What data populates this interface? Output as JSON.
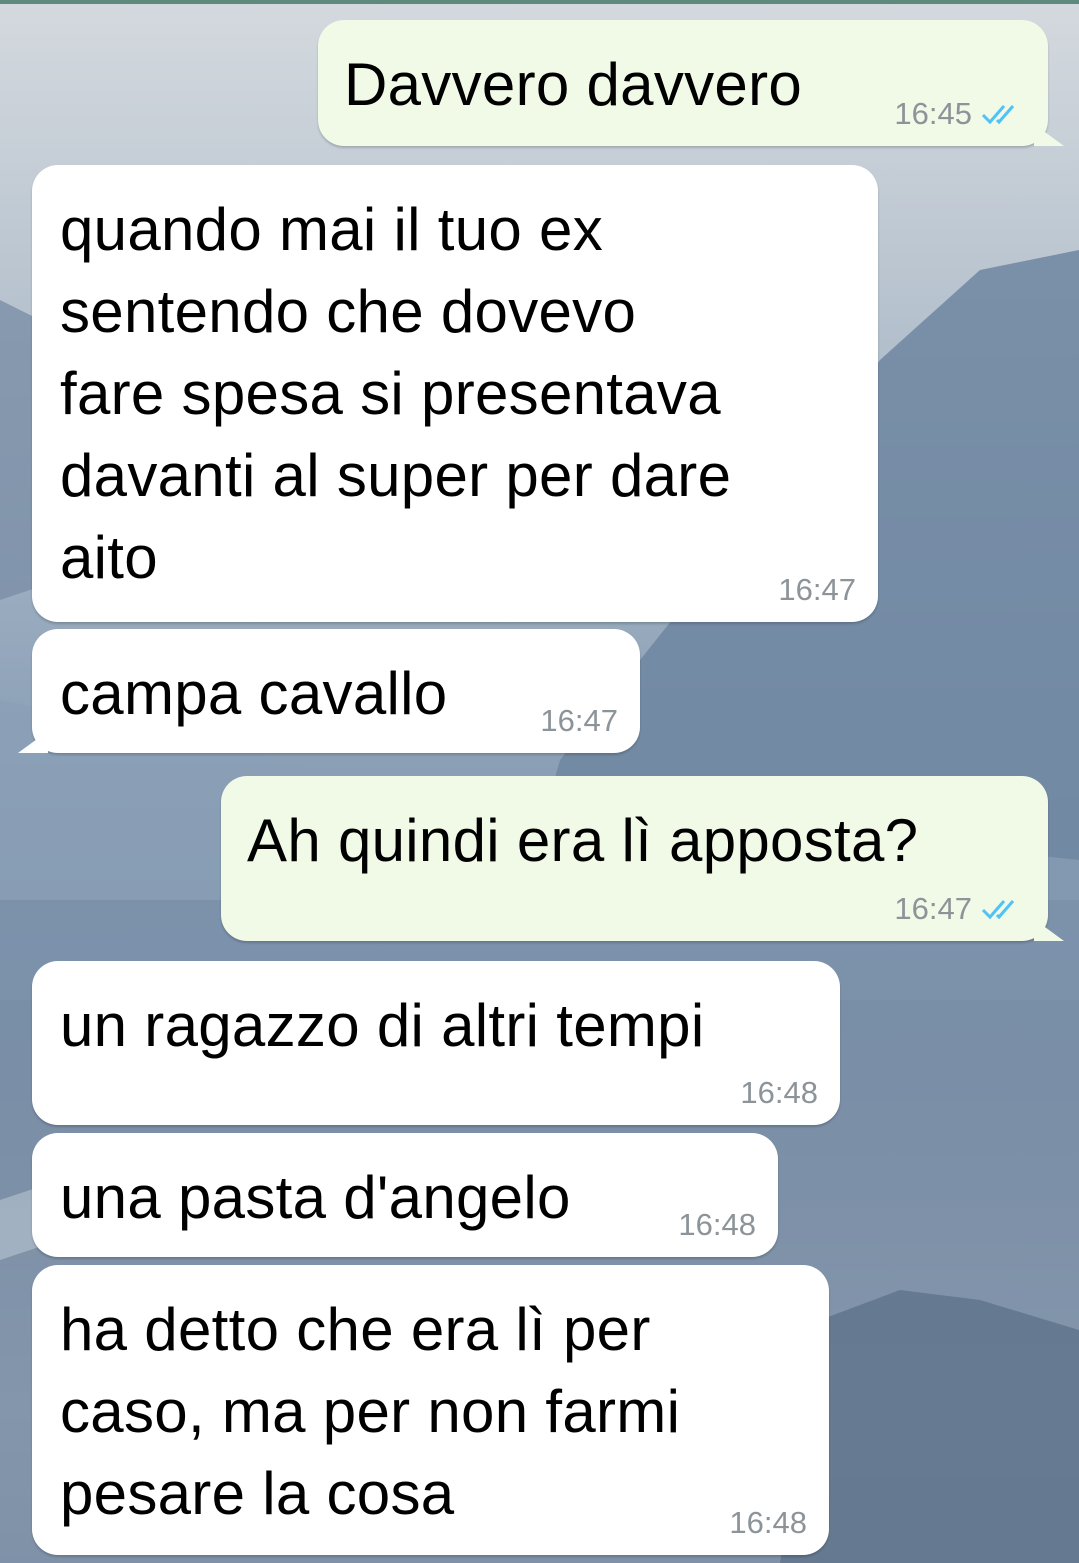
{
  "chat": {
    "messages": [
      {
        "direction": "out",
        "text": "Davvero davvero",
        "time": "16:45",
        "status": "read"
      },
      {
        "direction": "in",
        "text": "quando mai il tuo ex\nsentendo che dovevo\nfare spesa si presentava\ndavanti al super per dare\naito",
        "time": "16:47"
      },
      {
        "direction": "in",
        "text": "campa cavallo",
        "time": "16:47"
      },
      {
        "direction": "out",
        "text": "Ah quindi era lì apposta?",
        "time": "16:47",
        "status": "read"
      },
      {
        "direction": "in",
        "text": "un ragazzo di altri tempi",
        "time": "16:48"
      },
      {
        "direction": "in",
        "text": "una pasta d'angelo",
        "time": "16:48"
      },
      {
        "direction": "in",
        "text": "ha detto che era lì per\ncaso, ma per non farmi\npesare la cosa",
        "time": "16:48"
      }
    ]
  },
  "colors": {
    "incoming_bubble": "#ffffff",
    "outgoing_bubble": "#f1f9e7",
    "read_tick": "#4fc3f7",
    "timestamp": "#8d9499"
  }
}
